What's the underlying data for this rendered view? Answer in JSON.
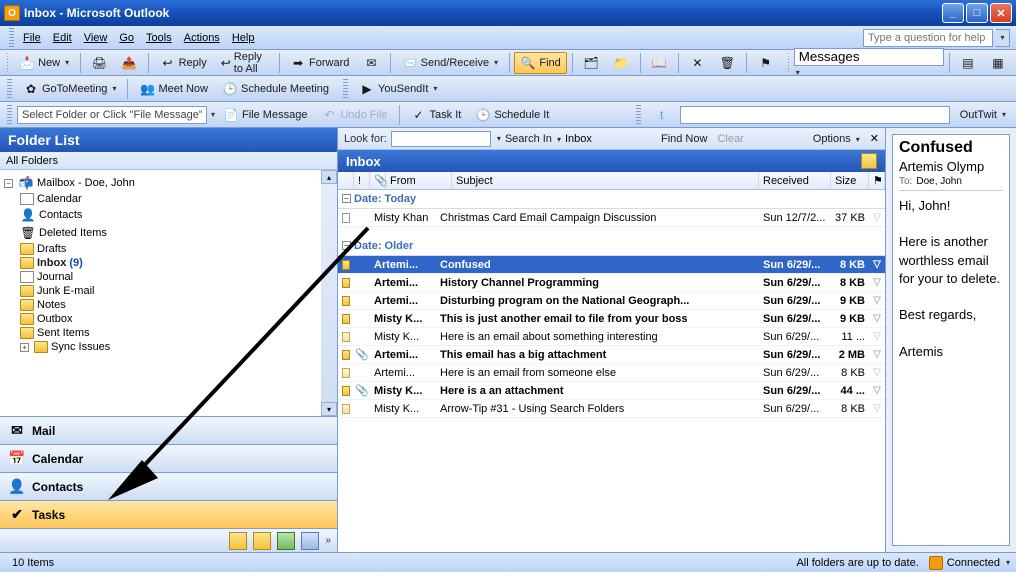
{
  "title": "Inbox - Microsoft Outlook",
  "menubar": {
    "file": "File",
    "edit": "Edit",
    "view": "View",
    "go": "Go",
    "tools": "Tools",
    "actions": "Actions",
    "help": "Help",
    "help_placeholder": "Type a question for help"
  },
  "tb1": {
    "new": "New",
    "reply": "Reply",
    "reply_all": "Reply to All",
    "forward": "Forward",
    "send_receive": "Send/Receive",
    "find": "Find",
    "messages": "Messages"
  },
  "tb2": {
    "gotomeeting": "GoToMeeting",
    "meet_now": "Meet Now",
    "schedule_meeting": "Schedule Meeting",
    "yousendit": "YouSendIt"
  },
  "tb3": {
    "placeholder": "Select Folder or Click \"File Message\"",
    "file_message": "File Message",
    "undo": "Undo File",
    "task_it": "Task It",
    "schedule_it": "Schedule It",
    "outtwit": "OutTwit"
  },
  "folderpane": {
    "title": "Folder List",
    "all_folders": "All Folders",
    "root": "Mailbox - Doe, John",
    "items": {
      "calendar": "Calendar",
      "contacts": "Contacts",
      "deleted": "Deleted Items",
      "drafts": "Drafts",
      "inbox": "Inbox",
      "inbox_count": "(9)",
      "journal": "Journal",
      "junk": "Junk E-mail",
      "notes": "Notes",
      "outbox": "Outbox",
      "sent": "Sent Items",
      "sync": "Sync Issues"
    }
  },
  "nav": {
    "mail": "Mail",
    "calendar": "Calendar",
    "contacts": "Contacts",
    "tasks": "Tasks"
  },
  "lookbar": {
    "lookfor": "Look for:",
    "searchin": "Search In",
    "inbox": "Inbox",
    "findnow": "Find Now",
    "clear": "Clear",
    "options": "Options"
  },
  "inbox_title": "Inbox",
  "columns": {
    "from": "From",
    "subject": "Subject",
    "received": "Received",
    "size": "Size"
  },
  "groups": {
    "today": "Date: Today",
    "older": "Date: Older"
  },
  "mails_today": [
    {
      "from": "Misty Khan",
      "subject": "Christmas Card Email Campaign Discussion",
      "received": "Sun 12/7/2...",
      "size": "37 KB",
      "read": true,
      "type": "cal"
    }
  ],
  "mails_older": [
    {
      "from": "Artemi...",
      "subject": "Confused",
      "received": "Sun 6/29/...",
      "size": "8 KB",
      "read": false,
      "sel": true
    },
    {
      "from": "Artemi...",
      "subject": "History Channel Programming",
      "received": "Sun 6/29/...",
      "size": "8 KB",
      "read": false
    },
    {
      "from": "Artemi...",
      "subject": "Disturbing program on the National Geograph...",
      "received": "Sun 6/29/...",
      "size": "9 KB",
      "read": false
    },
    {
      "from": "Misty K...",
      "subject": "This is just another email to file from your boss",
      "received": "Sun 6/29/...",
      "size": "9 KB",
      "read": false
    },
    {
      "from": "Misty K...",
      "subject": "Here is an email about something interesting",
      "received": "Sun 6/29/...",
      "size": "11 ...",
      "read": true
    },
    {
      "from": "Artemi...",
      "subject": "This email has a big attachment",
      "received": "Sun 6/29/...",
      "size": "2 MB",
      "read": false,
      "att": true
    },
    {
      "from": "Artemi...",
      "subject": "Here is an email from someone else",
      "received": "Sun 6/29/...",
      "size": "8 KB",
      "read": true
    },
    {
      "from": "Misty K...",
      "subject": "Here is a an attachment",
      "received": "Sun 6/29/...",
      "size": "44 ...",
      "read": false,
      "att": true
    },
    {
      "from": "Misty K...",
      "subject": "Arrow-Tip #31 - Using Search Folders",
      "received": "Sun 6/29/...",
      "size": "8 KB",
      "read": true
    }
  ],
  "reading": {
    "subject": "Confused",
    "from": "Artemis Olymp",
    "to_label": "To:",
    "to": "Doe, John",
    "body": "Hi, John!\n\nHere is another worthless email for your to delete.\n\nBest regards,\n\nArtemis"
  },
  "status": {
    "items": "10 Items",
    "sync": "All folders are up to date.",
    "conn": "Connected"
  }
}
